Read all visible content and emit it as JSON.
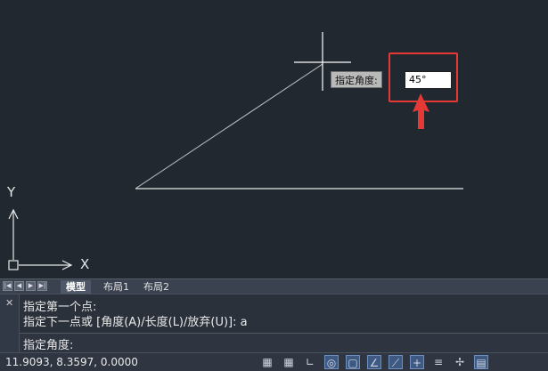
{
  "canvas": {
    "background": "#212830",
    "line_color": "#e8e8e8",
    "tooltip": {
      "label": "指定角度:",
      "value": "45°"
    },
    "highlight_color": "#e53935",
    "ucs": {
      "y_label": "Y",
      "x_label": "X"
    }
  },
  "tabs": {
    "nav_icons": [
      "first-icon",
      "prev-icon",
      "next-icon",
      "last-icon"
    ],
    "items": [
      {
        "label": "模型",
        "active": true
      },
      {
        "label": "布局1",
        "active": false
      },
      {
        "label": "布局2",
        "active": false
      }
    ]
  },
  "command": {
    "history": [
      "指定第一个点:",
      "指定下一点或 [角度(A)/长度(L)/放弃(U)]: a"
    ],
    "prompt": "指定角度:"
  },
  "status": {
    "coordinates": "11.9093, 8.3597, 0.0000"
  }
}
